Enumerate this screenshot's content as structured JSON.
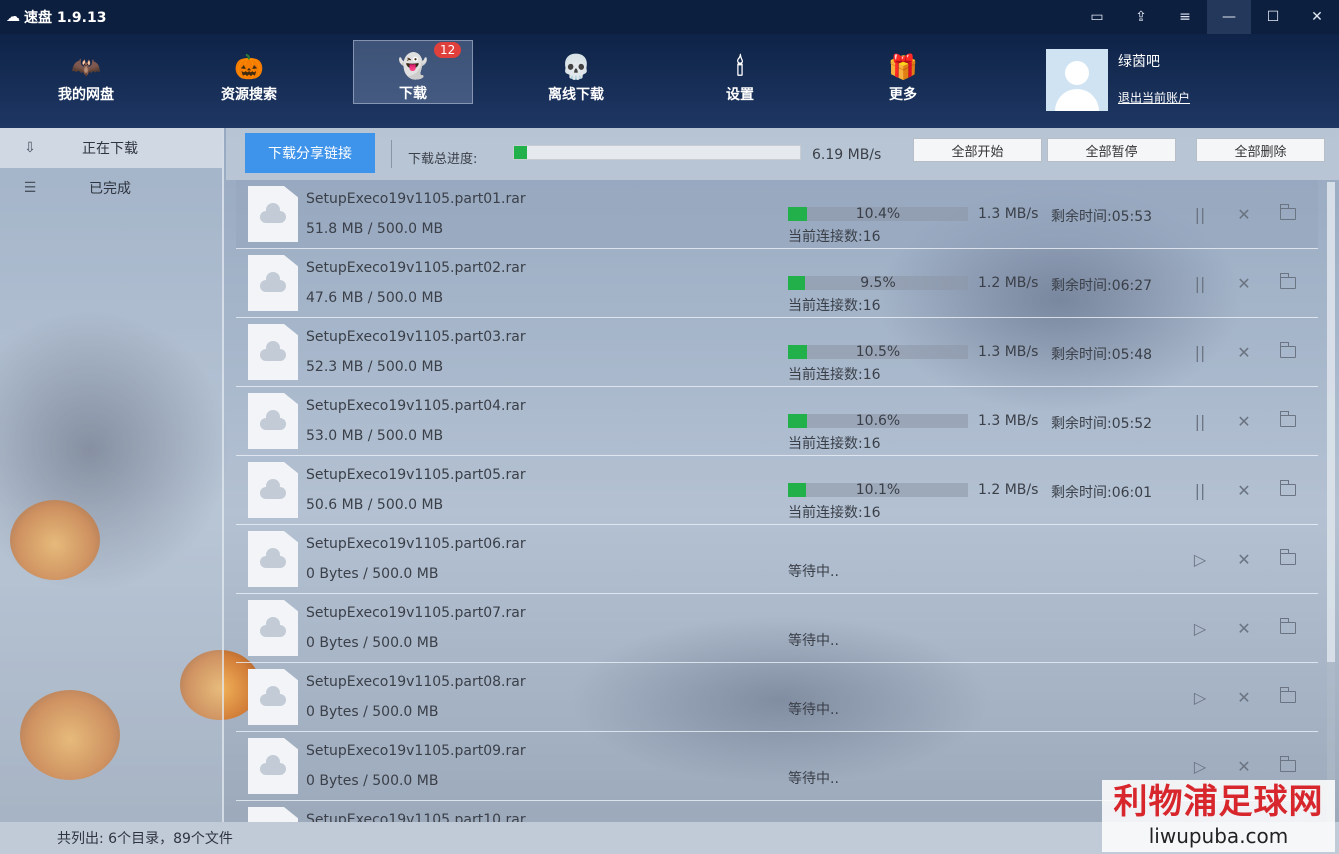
{
  "window": {
    "title": "速盘 1.9.13",
    "controls": [
      "▭",
      "⇪",
      "≡",
      "—",
      "☐",
      "✕"
    ]
  },
  "nav": {
    "items": [
      {
        "label": "我的网盘",
        "icon": "🦇"
      },
      {
        "label": "资源搜索",
        "icon": "🎃"
      },
      {
        "label": "下载",
        "icon": "👻",
        "badge": "12"
      },
      {
        "label": "离线下载",
        "icon": "💀"
      },
      {
        "label": "设置",
        "icon": "🕯"
      },
      {
        "label": "更多",
        "icon": "🎁"
      }
    ],
    "user": {
      "name": "绿茵吧",
      "logout": "退出当前账户"
    }
  },
  "sidebar": {
    "items": [
      {
        "label": "正在下载",
        "icon": "⇩"
      },
      {
        "label": "已完成",
        "icon": "☰"
      }
    ]
  },
  "toolbar": {
    "share_btn": "下载分享链接",
    "progress_label": "下载总进度:",
    "total_progress": 0.045,
    "total_speed": "6.19 MB/s",
    "start_all": "全部开始",
    "pause_all": "全部暂停",
    "delete_all": "全部删除"
  },
  "downloads": [
    {
      "name": "SetupExeco19v1105.part01.rar",
      "size": "51.8 MB / 500.0 MB",
      "status": "active",
      "percent": "10.4%",
      "progress": 0.104,
      "speed": "1.3 MB/s",
      "remain": "剩余时间:05:53",
      "conn": "当前连接数:16"
    },
    {
      "name": "SetupExeco19v1105.part02.rar",
      "size": "47.6 MB / 500.0 MB",
      "status": "active",
      "percent": "9.5%",
      "progress": 0.095,
      "speed": "1.2 MB/s",
      "remain": "剩余时间:06:27",
      "conn": "当前连接数:16"
    },
    {
      "name": "SetupExeco19v1105.part03.rar",
      "size": "52.3 MB / 500.0 MB",
      "status": "active",
      "percent": "10.5%",
      "progress": 0.105,
      "speed": "1.3 MB/s",
      "remain": "剩余时间:05:48",
      "conn": "当前连接数:16"
    },
    {
      "name": "SetupExeco19v1105.part04.rar",
      "size": "53.0 MB / 500.0 MB",
      "status": "active",
      "percent": "10.6%",
      "progress": 0.106,
      "speed": "1.3 MB/s",
      "remain": "剩余时间:05:52",
      "conn": "当前连接数:16"
    },
    {
      "name": "SetupExeco19v1105.part05.rar",
      "size": "50.6 MB / 500.0 MB",
      "status": "active",
      "percent": "10.1%",
      "progress": 0.101,
      "speed": "1.2 MB/s",
      "remain": "剩余时间:06:01",
      "conn": "当前连接数:16"
    },
    {
      "name": "SetupExeco19v1105.part06.rar",
      "size": "0 Bytes / 500.0 MB",
      "status": "waiting",
      "waiting": "等待中.."
    },
    {
      "name": "SetupExeco19v1105.part07.rar",
      "size": "0 Bytes / 500.0 MB",
      "status": "waiting",
      "waiting": "等待中.."
    },
    {
      "name": "SetupExeco19v1105.part08.rar",
      "size": "0 Bytes / 500.0 MB",
      "status": "waiting",
      "waiting": "等待中.."
    },
    {
      "name": "SetupExeco19v1105.part09.rar",
      "size": "0 Bytes / 500.0 MB",
      "status": "waiting",
      "waiting": "等待中.."
    },
    {
      "name": "SetupExeco19v1105.part10.rar",
      "size": "",
      "status": "partial"
    }
  ],
  "status": {
    "text": "共列出: 6个目录，89个文件"
  },
  "watermark": {
    "big": "利物浦足球网",
    "small": "liwupuba.com"
  },
  "icons": {
    "pause": "||",
    "close": "✕",
    "play": "▷",
    "cloud": "☁"
  }
}
